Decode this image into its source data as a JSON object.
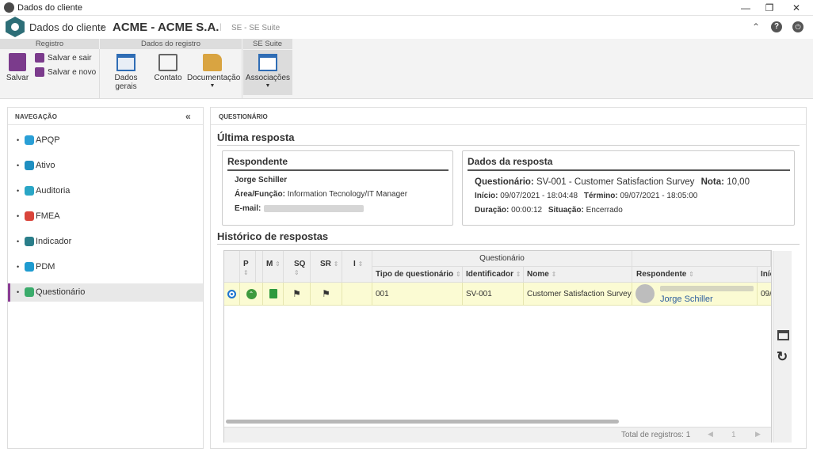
{
  "window": {
    "title": "Dados do cliente"
  },
  "header": {
    "crumb": "Dados do cliente",
    "title": "ACME - ACME S.A.",
    "separator": "|",
    "suite": "SE - SE Suite"
  },
  "ribbon": {
    "groups": [
      "Registro",
      "Dados do registro",
      "SE Suite"
    ],
    "save": "Salvar",
    "save_exit": "Salvar e sair",
    "save_new": "Salvar e novo",
    "general": "Dados gerais",
    "contact": "Contato",
    "documentation": "Documentação",
    "associations": "Associações"
  },
  "nav": {
    "title": "NAVEGAÇÃO",
    "items": [
      {
        "label": "APQP",
        "color": "#2a9fd6"
      },
      {
        "label": "Ativo",
        "color": "#1f8fc1"
      },
      {
        "label": "Auditoria",
        "color": "#2aa6c6"
      },
      {
        "label": "FMEA",
        "color": "#d9453b"
      },
      {
        "label": "Indicador",
        "color": "#2a7e8a"
      },
      {
        "label": "PDM",
        "color": "#1e9bd0"
      },
      {
        "label": "Questionário",
        "color": "#3aab6b"
      }
    ]
  },
  "main": {
    "title": "QUESTIONÁRIO",
    "last_response_title": "Última resposta",
    "respondent_card": {
      "title": "Respondente",
      "name": "Jorge Schiller",
      "role_label": "Área/Função:",
      "role_value": "Information Tecnology/IT Manager",
      "email_label": "E-mail:"
    },
    "response_card": {
      "title": "Dados da resposta",
      "questionnaire_label": "Questionário:",
      "questionnaire_value": "SV-001 - Customer Satisfaction Survey",
      "score_label": "Nota:",
      "score_value": "10,00",
      "start_label": "Início:",
      "start_value": "09/07/2021 - 18:04:48",
      "end_label": "Término:",
      "end_value": "09/07/2021 - 18:05:00",
      "duration_label": "Duração:",
      "duration_value": "00:00:12",
      "status_label": "Situação:",
      "status_value": "Encerrado"
    },
    "history_title": "Histórico de respostas",
    "grid": {
      "group_header": "Questionário",
      "columns": {
        "p": "P",
        "m": "M",
        "sq": "SQ",
        "sr": "SR",
        "i": "I",
        "type": "Tipo de questionário",
        "id": "Identificador",
        "name": "Nome",
        "respondent": "Respondente",
        "start": "Iníc"
      },
      "row": {
        "type": "001",
        "id": "SV-001",
        "name": "Customer Satisfaction Survey",
        "respondent": "Jorge Schiller",
        "start": "09/"
      },
      "footer": {
        "total": "Total de registros: 1",
        "page": "1"
      }
    }
  }
}
